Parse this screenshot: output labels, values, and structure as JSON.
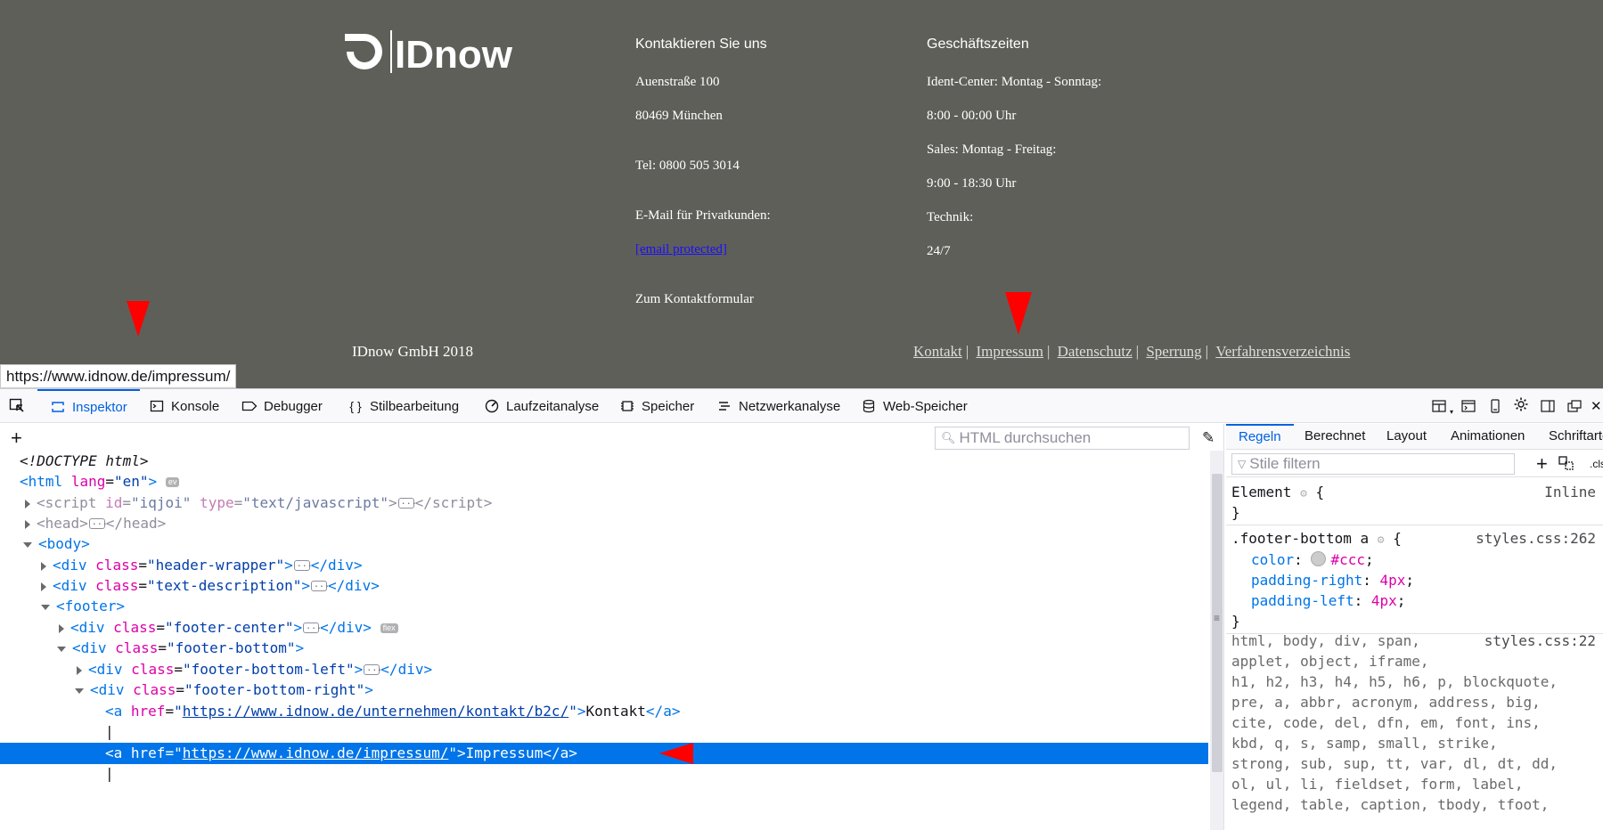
{
  "page": {
    "logo_text": "IDnow",
    "contact": {
      "heading": "Kontaktieren Sie uns",
      "street": "Auenstraße 100",
      "city": "80469 München",
      "phone": "Tel: 0800 505 3014",
      "email_label": "E-Mail für Privatkunden:",
      "email_link": "[email protected]",
      "contact_form": "Zum Kontaktformular"
    },
    "hours": {
      "heading": "Geschäftszeiten",
      "ident_label": "Ident-Center: Montag - Sonntag:",
      "ident_hours": "8:00 - 00:00 Uhr",
      "sales_label": "Sales: Montag - Freitag:",
      "sales_hours": "9:00 - 18:30 Uhr",
      "tech_label": "Technik:",
      "tech_hours": "24/7"
    },
    "copyright": "IDnow GmbH 2018",
    "footer_links": [
      "Kontakt",
      "Impressum",
      "Datenschutz",
      "Sperrung",
      "Verfahrensverzeichnis"
    ],
    "separator": "|",
    "status_url": "https://www.idnow.de/impressum/"
  },
  "devtools": {
    "tabs": [
      {
        "label": "Inspektor",
        "icon": "inspector-icon",
        "active": true
      },
      {
        "label": "Konsole",
        "icon": "console-icon",
        "active": false
      },
      {
        "label": "Debugger",
        "icon": "debugger-icon",
        "active": false
      },
      {
        "label": "Stilbearbeitung",
        "icon": "style-editor-icon",
        "active": false
      },
      {
        "label": "Laufzeitanalyse",
        "icon": "performance-icon",
        "active": false
      },
      {
        "label": "Speicher",
        "icon": "memory-icon",
        "active": false
      },
      {
        "label": "Netzwerkanalyse",
        "icon": "network-icon",
        "active": false
      },
      {
        "label": "Web-Speicher",
        "icon": "storage-icon",
        "active": false
      }
    ],
    "search_placeholder": "HTML durchsuchen",
    "tree": {
      "doctype": "<!DOCTYPE html>",
      "html_lang": "en",
      "script_id": "iqjoi",
      "script_type": "text/javascript",
      "div_header_class": "header-wrapper",
      "div_text_class": "text-description",
      "div_footer_center_class": "footer-center",
      "flex_badge": "flex",
      "ev_badge": "ev",
      "div_footer_bottom_class": "footer-bottom",
      "div_footer_bottom_left_class": "footer-bottom-left",
      "div_footer_bottom_right_class": "footer-bottom-right",
      "link1_href": "https://www.idnow.de/unternehmen/kontakt/b2c/",
      "link1_text": "Kontakt",
      "link2_href": "https://www.idnow.de/impressum/",
      "link2_text": "Impressum",
      "pipe": "|"
    },
    "rules_tabs": [
      "Regeln",
      "Berechnet",
      "Layout",
      "Animationen",
      "Schriftarten"
    ],
    "rules_filter_placeholder": "Stile filtern",
    "rules_cls": ".cls",
    "rules": {
      "element_selector": "Element",
      "element_source": "Inline",
      "footer_selector": ".footer-bottom a",
      "footer_source": "styles.css:262",
      "color_prop": "color",
      "color_val": "#ccc",
      "pr_prop": "padding-right",
      "pr_val": "4px",
      "pl_prop": "padding-left",
      "pl_val": "4px",
      "reset_source": "styles.css:22",
      "reset_lines": [
        "html, body, div, span,",
        "applet, object, iframe,",
        "h1, h2, h3, h4, h5, h6, p, blockquote,",
        "pre, a, abbr, acronym, address, big,",
        "cite, code, del, dfn, em, font, ins,",
        "kbd, q, s, samp, small, strike,",
        "strong, sub, sup, tt, var, dl, dt, dd,",
        "ol, ul, li, fieldset, form, label,",
        "legend, table, caption, tbody, tfoot,"
      ]
    }
  }
}
